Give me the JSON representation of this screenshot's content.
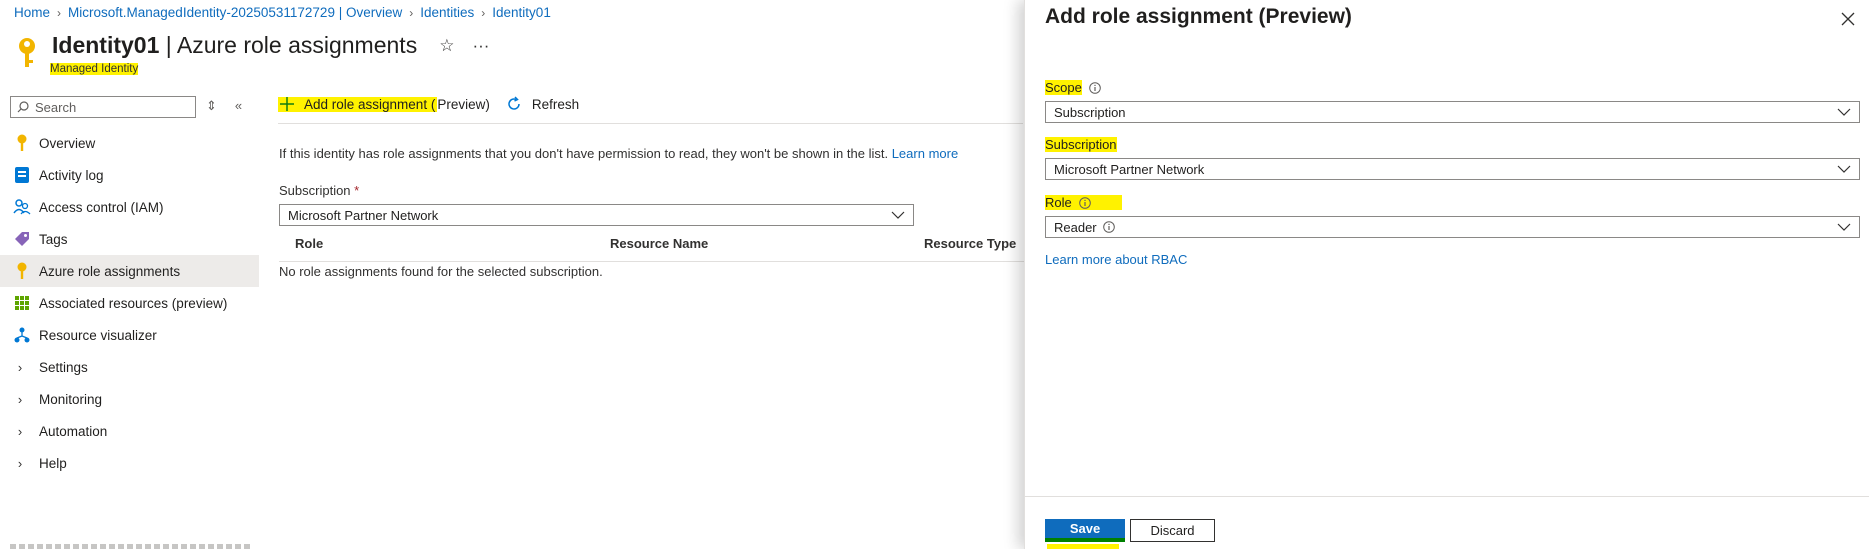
{
  "breadcrumb": [
    "Home",
    "Microsoft.ManagedIdentity-20250531172729 | Overview",
    "Identities",
    "Identity01"
  ],
  "header": {
    "title_bold": "Identity01",
    "title_rest": " | Azure role assignments",
    "subtitle": "Managed Identity",
    "favorite_icon": "star-icon",
    "more_icon": "ellipsis-icon"
  },
  "sidebar": {
    "search_placeholder": "Search",
    "items": [
      {
        "label": "Overview",
        "icon": "key-icon"
      },
      {
        "label": "Activity log",
        "icon": "activity-log-icon"
      },
      {
        "label": "Access control (IAM)",
        "icon": "people-icon"
      },
      {
        "label": "Tags",
        "icon": "tag-icon"
      },
      {
        "label": "Azure role assignments",
        "icon": "key-icon",
        "active": true
      },
      {
        "label": "Associated resources (preview)",
        "icon": "grid-icon"
      },
      {
        "label": "Resource visualizer",
        "icon": "visualizer-icon"
      },
      {
        "label": "Settings",
        "icon": "chevron-right-icon"
      },
      {
        "label": "Monitoring",
        "icon": "chevron-right-icon"
      },
      {
        "label": "Automation",
        "icon": "chevron-right-icon"
      },
      {
        "label": "Help",
        "icon": "chevron-right-icon"
      }
    ]
  },
  "toolbar": {
    "add_label_hl": "Add role assignment (",
    "add_label_rest": "Preview)",
    "refresh_label": "Refresh"
  },
  "main": {
    "info_text": "If this identity has role assignments that you don't have permission to read, they won't be shown in the list.",
    "info_link": "Learn more",
    "subscription_label": "Subscription",
    "subscription_required": "*",
    "subscription_value": "Microsoft Partner Network",
    "columns": [
      "Role",
      "Resource Name",
      "Resource Type"
    ],
    "empty_text": "No role assignments found for the selected subscription."
  },
  "panel": {
    "title": "Add role assignment (Preview)",
    "scope_label": "Scope",
    "scope_value": "Subscription",
    "subscription_label": "Subscription",
    "subscription_value": "Microsoft Partner Network",
    "role_label": "Role",
    "role_value": "Reader",
    "rbac_link": "Learn more about RBAC",
    "save_label": "Save",
    "discard_label": "Discard"
  },
  "colors": {
    "accent": "#0f6cbd",
    "highlight": "#fff200",
    "active_nav": "#edebe9"
  }
}
